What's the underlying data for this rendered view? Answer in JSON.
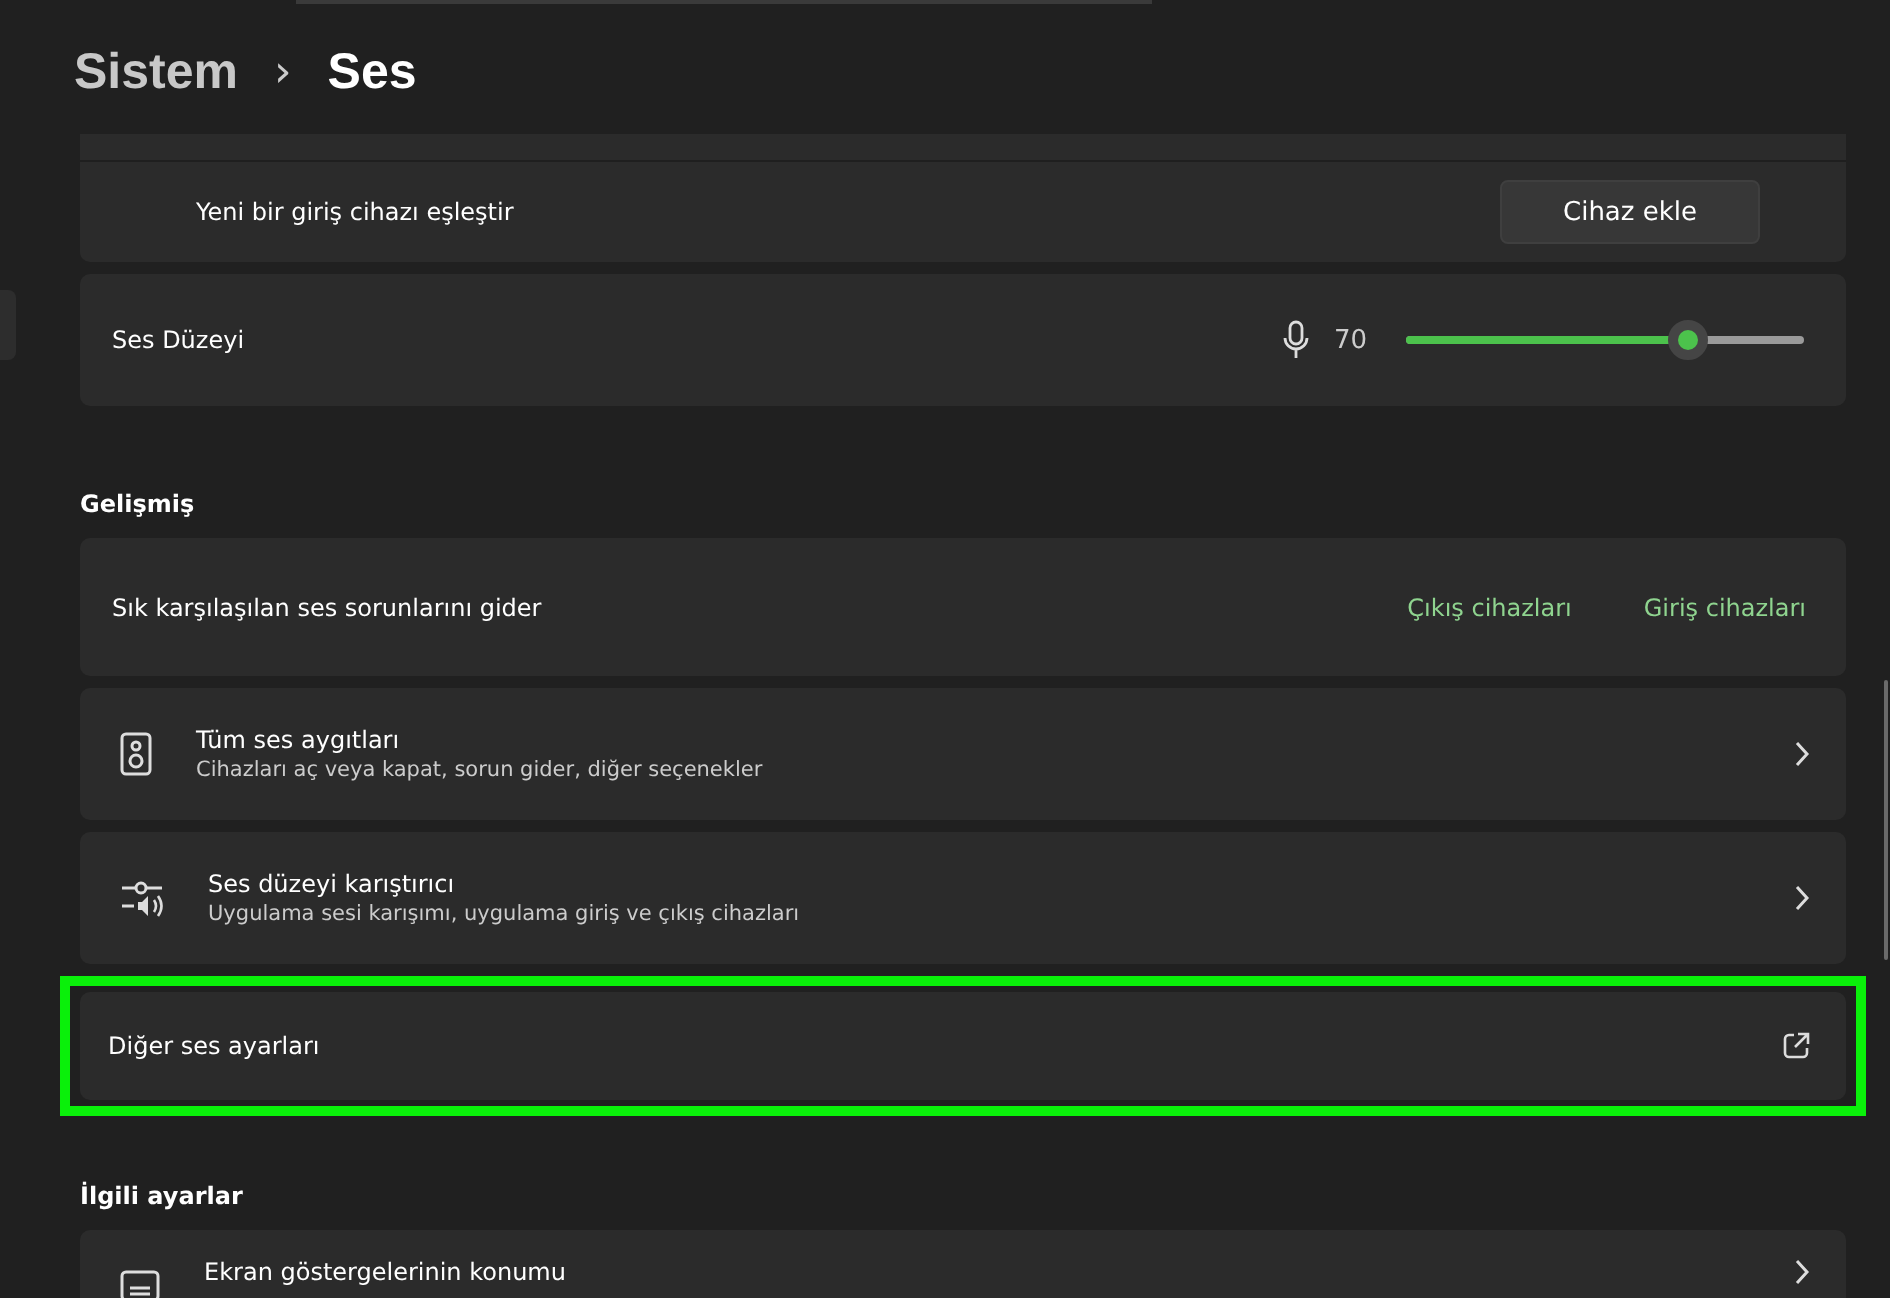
{
  "breadcrumb": {
    "parent": "Sistem",
    "separator": "›",
    "current": "Ses"
  },
  "input_device": {
    "pair_label": "Yeni bir giriş cihazı eşleştir",
    "pair_button": "Cihaz ekle"
  },
  "volume": {
    "label": "Ses Düzeyi",
    "reading": "70",
    "level": 0.7
  },
  "advanced": {
    "heading": "Gelişmiş",
    "troubleshoot": {
      "label": "Sık karşılaşılan ses sorunlarını gider",
      "links": [
        "Çıkış cihazları",
        "Giriş cihazları"
      ]
    },
    "items": [
      {
        "kind": "speaker",
        "title": "Tüm ses aygıtları",
        "subtitle": "Cihazları aç veya kapat, sorun gider, diğer seçenekler",
        "external": false,
        "highlighted": false
      },
      {
        "kind": "mixer",
        "title": "Ses düzeyi karıştırıcı",
        "subtitle": "Uygulama sesi karışımı, uygulama giriş ve çıkış cihazları",
        "external": false,
        "highlighted": false
      },
      {
        "kind": "none",
        "title": "Diğer ses ayarları",
        "external": true,
        "highlighted": true
      }
    ]
  },
  "related": {
    "heading": "İlgili ayarlar",
    "items": [
      {
        "kind": "display",
        "title": "Ekran göstergelerinin konumu",
        "external": false
      }
    ]
  }
}
